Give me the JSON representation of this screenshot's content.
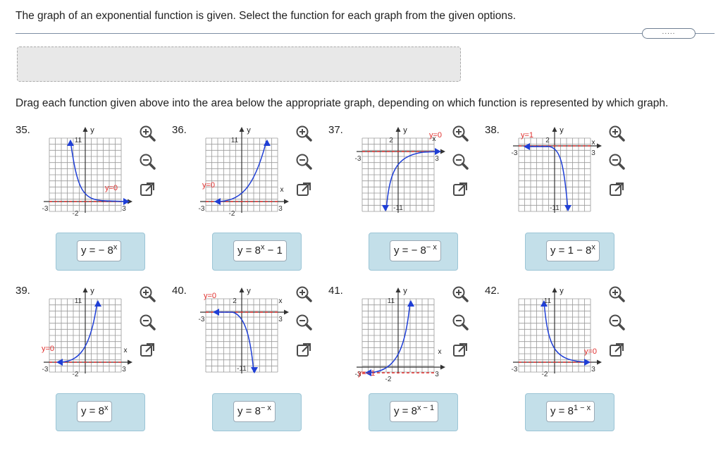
{
  "question": "The graph of an exponential function is given. Select the function for each graph from the given options.",
  "more_button": ".....",
  "instruction": "Drag each function given above into the area below the appropriate graph, depending on which function is represented by which graph.",
  "colors": {
    "curve": "#1f3fd6",
    "asymptote": "#e0302e",
    "dropzone": "#c3dfe9",
    "tool": "#4a4a4a"
  },
  "tools": [
    "zoom-in-icon",
    "zoom-out-icon",
    "enlarge-icon"
  ],
  "graphs": [
    {
      "number": "35.",
      "axis_y": "y",
      "axis_x": "",
      "xmin": "-3",
      "xmax": "3",
      "tick_y": "11",
      "tick_neg": "-2",
      "asymptote_label": "y=0",
      "answer": {
        "base": "y = − 8",
        "exp": "x"
      }
    },
    {
      "number": "36.",
      "axis_y": "y",
      "axis_x": "x",
      "xmin": "-3",
      "xmax": "3",
      "tick_y": "11",
      "tick_neg": "-2",
      "asymptote_label": "y=0",
      "answer": {
        "base": "y = 8",
        "exp": "x",
        "tail": " − 1"
      }
    },
    {
      "number": "37.",
      "axis_y": "y",
      "axis_x": "x",
      "xmin": "-3",
      "xmax": "3",
      "tick_y": "2",
      "tick_neg": "-11",
      "asymptote_label": "y=0",
      "answer": {
        "base": "y = − 8",
        "exp": "− x"
      }
    },
    {
      "number": "38.",
      "axis_y": "y",
      "axis_x": "x",
      "xmin": "-3",
      "xmax": "3",
      "tick_y": "2",
      "tick_neg": "-11",
      "asymptote_label": "y=1",
      "answer": {
        "base": "y = 1 − 8",
        "exp": "x"
      }
    },
    {
      "number": "39.",
      "axis_y": "y",
      "axis_x": "x",
      "xmin": "-3",
      "xmax": "3",
      "tick_y": "11",
      "tick_neg": "-2",
      "asymptote_label": "y=0",
      "answer": {
        "base": "y = 8",
        "exp": "x"
      }
    },
    {
      "number": "40.",
      "axis_y": "y",
      "axis_x": "x",
      "xmin": "-3",
      "xmax": "3",
      "tick_y": "2",
      "tick_neg": "-11",
      "asymptote_label": "y=0",
      "answer": {
        "base": "y = 8",
        "exp": "− x"
      }
    },
    {
      "number": "41.",
      "axis_y": "y",
      "axis_x": "x",
      "xmin": "-3",
      "xmax": "3",
      "tick_y": "11",
      "tick_neg": "-2",
      "asymptote_label": "y=−1",
      "answer": {
        "base": "y = 8",
        "exp": "x − 1"
      }
    },
    {
      "number": "42.",
      "axis_y": "y",
      "axis_x": "",
      "xmin": "-3",
      "xmax": "3",
      "tick_y": "11",
      "tick_neg": "-2",
      "asymptote_label": "y=0",
      "answer": {
        "base": "y = 8",
        "exp": "1 − x"
      }
    }
  ]
}
